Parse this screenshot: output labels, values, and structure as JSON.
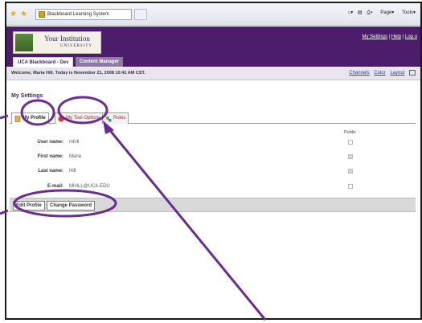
{
  "browser": {
    "tab_title": "Blackboard Learning System",
    "tools": [
      "Page",
      "Tools"
    ]
  },
  "institution": {
    "name": "Your Institution",
    "subname": "UNIVERSITY"
  },
  "top_links": {
    "settings": "My Settings",
    "help": "Help",
    "logout": "Log o"
  },
  "tabs": {
    "course": "UCA Blackboard - Dev",
    "content": "Content Manager"
  },
  "welcome": {
    "text": "Welcome, Maria Hill. Today is November 21, 2008 10:41 AM CST."
  },
  "header_links": {
    "channels": "Channels",
    "color": "Color",
    "layout": "Layout"
  },
  "page": {
    "title": "My Settings",
    "subtabs": {
      "profile": "My Profile",
      "tools": "My Tool Options",
      "roles": "Roles"
    },
    "public_header": "Public",
    "fields": [
      {
        "label": "User name:",
        "value": "mhill"
      },
      {
        "label": "First name:",
        "value": "Maria"
      },
      {
        "label": "Last name:",
        "value": "Hill"
      },
      {
        "label": "E-mail:",
        "value": "MHILL@UCA.EDU"
      }
    ],
    "buttons": {
      "edit": "Edit Profile",
      "password": "Change Password"
    }
  },
  "annotation_color": "#6b2c91"
}
